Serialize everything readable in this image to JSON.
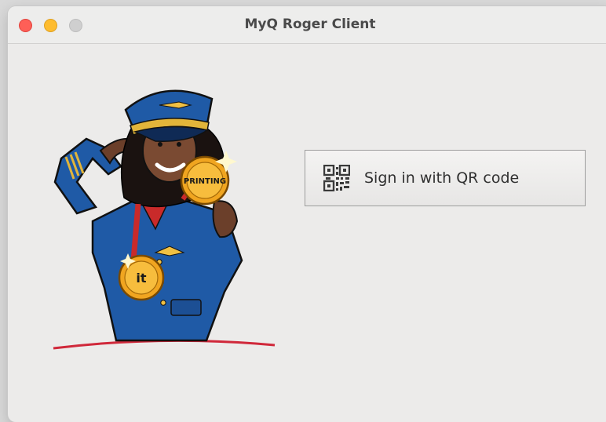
{
  "window": {
    "title": "MyQ Roger Client"
  },
  "mascot": {
    "medal_top_text": "PRINTING",
    "medal_bottom_text": "it"
  },
  "sign_in": {
    "qr_button_label": "Sign in with QR code",
    "icon": "qr-code-icon"
  },
  "colors": {
    "close": "#fe5f57",
    "minimize": "#febc2e",
    "maximize_inactive": "#cfcfcf",
    "uniform_blue": "#1f5aa6",
    "medal_gold": "#f0a520"
  }
}
